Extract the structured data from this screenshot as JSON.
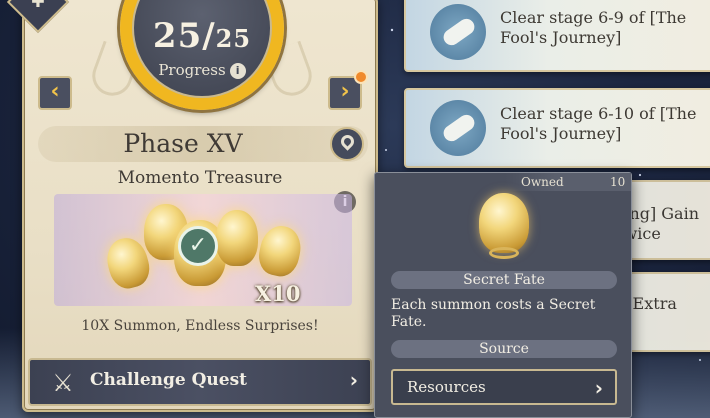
{
  "progress": {
    "count": "25",
    "separator": "/",
    "total": "25",
    "label": "Progress",
    "info_icon": "i",
    "ring_color": "#f0b720"
  },
  "phase": {
    "title": "Phase XV"
  },
  "treasure": {
    "name": "Momento Treasure",
    "info_icon": "i",
    "multiplier": "X10",
    "tagline": "10X Summon, Endless Surprises!"
  },
  "challenge": {
    "label": "Challenge Quest",
    "chevron": "›"
  },
  "nav": {
    "prev": "‹",
    "next": "›"
  },
  "quests": [
    {
      "text": "Clear stage 6-9 of [The Fool's Journey]"
    },
    {
      "text": "Clear stage 6-10 of [The Fool's Journey]"
    },
    {
      "text": "[Level-up Training] Gain Extra Reward twice"
    },
    {
      "text": "[Potential] Gain Extra Reward twice"
    }
  ],
  "popup": {
    "owned_label": "Owned",
    "owned_count": "10",
    "item_name": "Secret Fate",
    "description": "Each summon costs a Secret Fate.",
    "source_label": "Source",
    "resources_label": "Resources",
    "chevron": "›"
  },
  "icons": {
    "check": "✓",
    "corner": "✚",
    "challenge": "⚔"
  }
}
